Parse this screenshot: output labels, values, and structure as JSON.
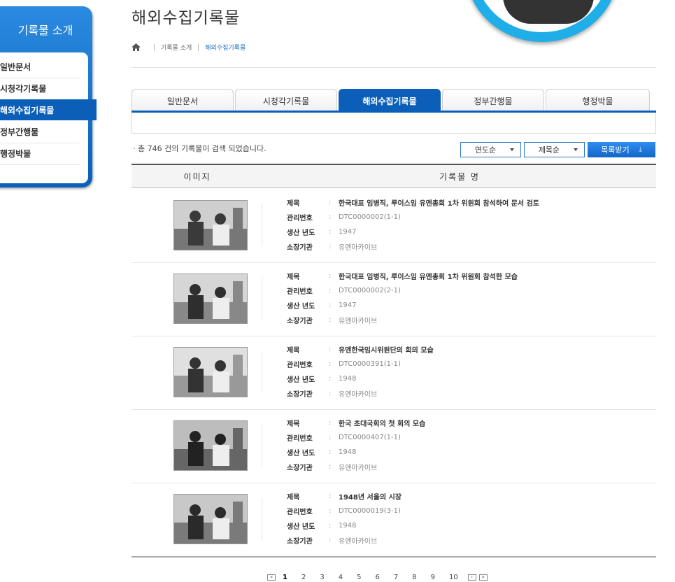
{
  "sidebar": {
    "title": "기록물 소개",
    "items": [
      {
        "label": "일반문서",
        "active": false
      },
      {
        "label": "시청각기록물",
        "active": false
      },
      {
        "label": "해외수집기록물",
        "active": true
      },
      {
        "label": "정부간행물",
        "active": false
      },
      {
        "label": "행정박물",
        "active": false
      }
    ]
  },
  "header": {
    "title": "해외수집기록물",
    "breadcrumb": {
      "home_icon": "home-icon",
      "level1": "기록물 소개",
      "current": "해외수집기록물"
    }
  },
  "tabs": [
    {
      "label": "일반문서",
      "active": false
    },
    {
      "label": "시청각기록물",
      "active": false
    },
    {
      "label": "해외수집기록물",
      "active": true
    },
    {
      "label": "정부간행물",
      "active": false
    },
    {
      "label": "행정박물",
      "active": false
    }
  ],
  "results": {
    "count_text": "· 총 746 건의 기록물이 검색 되었습니다.",
    "sort_year": "연도순",
    "sort_title": "제목순",
    "download_label": "목록받기",
    "download_icon": "download-icon"
  },
  "table": {
    "col_image": "이미지",
    "col_name": "기록물 명",
    "labels": {
      "title": "제목",
      "id": "관리번호",
      "year": "생산 년도",
      "holder": "소장기관"
    },
    "rows": [
      {
        "title": "한국대표 임병직, 루이스임 유엔총회 1차 위원회 참석하여 문서 검토",
        "id": "DTC0000002(1-1)",
        "year": "1947",
        "holder": "유엔아카이브"
      },
      {
        "title": "한국대표 임병직, 루이스임 유엔총회 1차 위원회 참석한 모습",
        "id": "DTC0000002(2-1)",
        "year": "1947",
        "holder": "유엔아카이브"
      },
      {
        "title": "유엔한국임시위원단의 회의 모습",
        "id": "DTC0000391(1-1)",
        "year": "1948",
        "holder": "유엔아카이브"
      },
      {
        "title": "한국 초대국회의 첫 회의 모습",
        "id": "DTC0000407(1-1)",
        "year": "1948",
        "holder": "유엔아카이브"
      },
      {
        "title": "1948년 서울의 시장",
        "id": "DTC0000019(3-1)",
        "year": "1948",
        "holder": "유엔아카이브"
      }
    ]
  },
  "pagination": {
    "first": "«",
    "prev": "‹",
    "next": "›",
    "last": "»",
    "pages": [
      "1",
      "2",
      "3",
      "4",
      "5",
      "6",
      "7",
      "8",
      "9",
      "10"
    ],
    "current": "1"
  },
  "colors": {
    "primary": "#0b5fb8",
    "accent": "#1faee8"
  }
}
